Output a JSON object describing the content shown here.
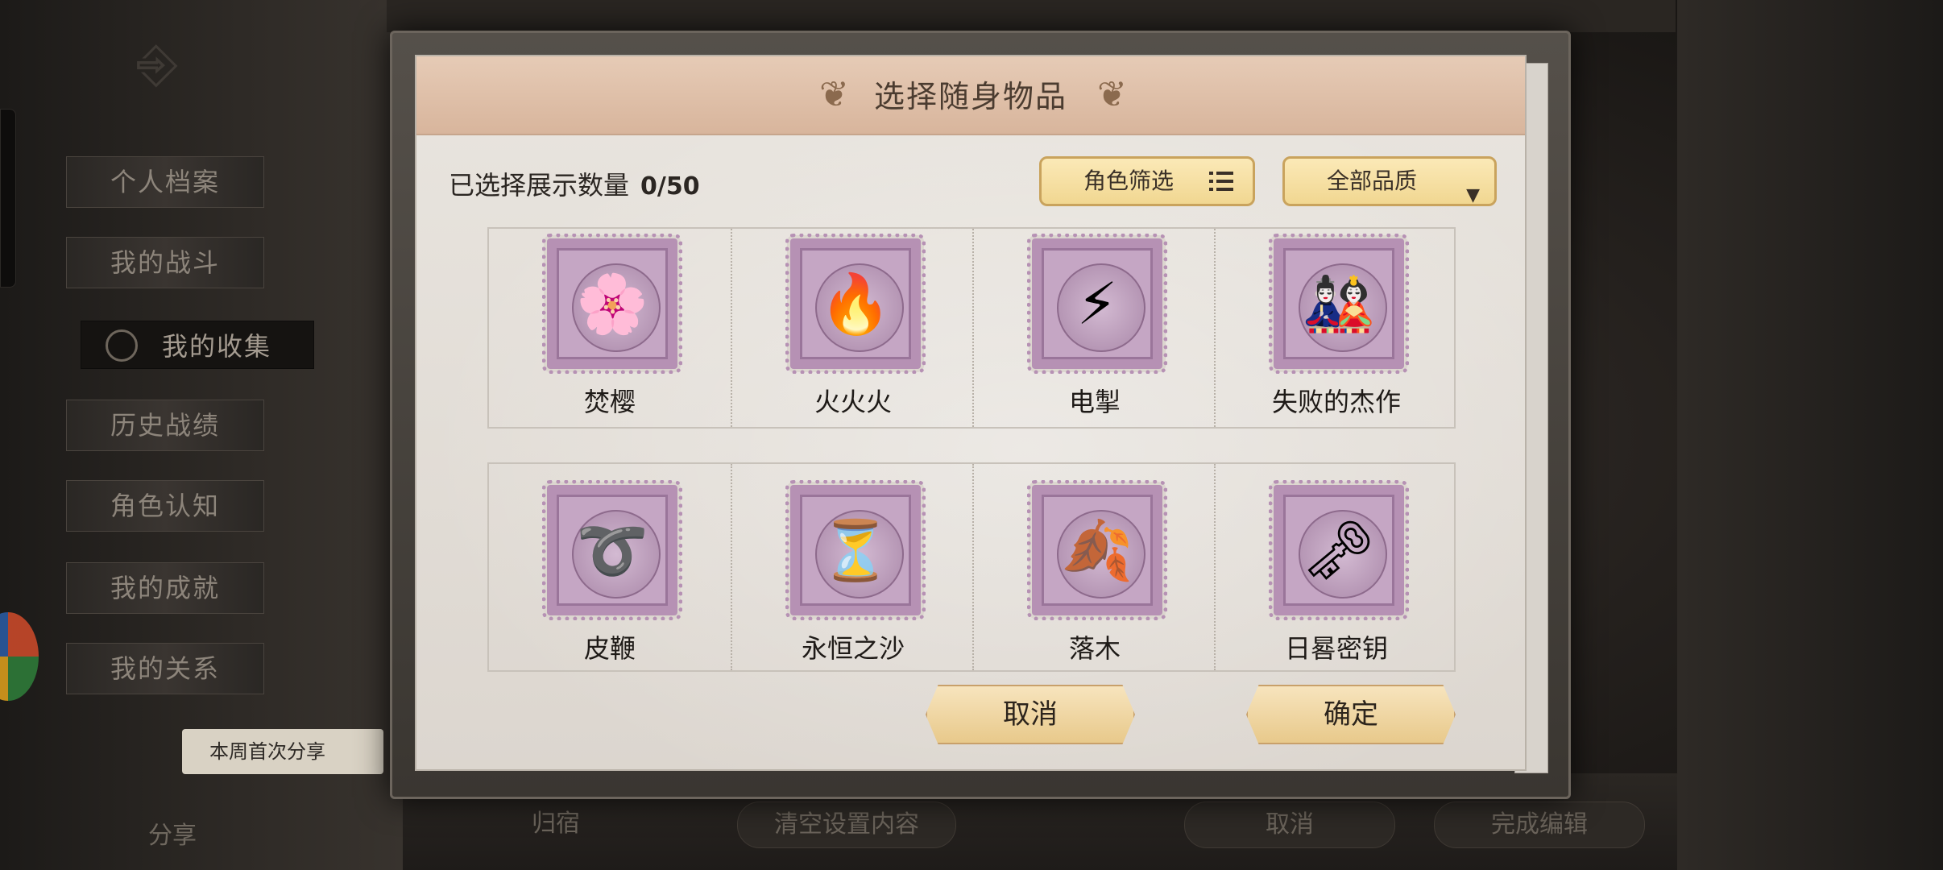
{
  "background": {
    "menu_items": [
      "个人档案",
      "我的战斗",
      "我的收集",
      "历史战绩",
      "角色认知",
      "我的成就",
      "我的关系"
    ],
    "share_badge": "本周首次分享",
    "share_label": "分享",
    "bottom_buttons": [
      "归宿",
      "清空设置内容",
      "取消",
      "完成编辑"
    ]
  },
  "modal": {
    "title": "选择随身物品",
    "count_label": "已选择展示数量",
    "count_value": "0/50",
    "role_filter_label": "角色筛选",
    "quality_filter_label": "全部品质",
    "cancel_label": "取消",
    "confirm_label": "确定"
  },
  "items_row1": [
    {
      "name": "焚樱",
      "icon": "sakura-charm-icon"
    },
    {
      "name": "火火火",
      "icon": "fire-torch-icon"
    },
    {
      "name": "电掣",
      "icon": "lightning-glove-icon"
    },
    {
      "name": "失败的杰作",
      "icon": "doll-icon"
    }
  ],
  "items_row2": [
    {
      "name": "皮鞭",
      "icon": "whip-icon"
    },
    {
      "name": "永恒之沙",
      "icon": "hourglass-icon"
    },
    {
      "name": "落木",
      "icon": "leaf-frame-icon"
    },
    {
      "name": "日晷密钥",
      "icon": "key-icon"
    }
  ],
  "colors": {
    "stamp": "#b691b4",
    "button_gold": "#f1d791",
    "header": "#d8b59c"
  }
}
